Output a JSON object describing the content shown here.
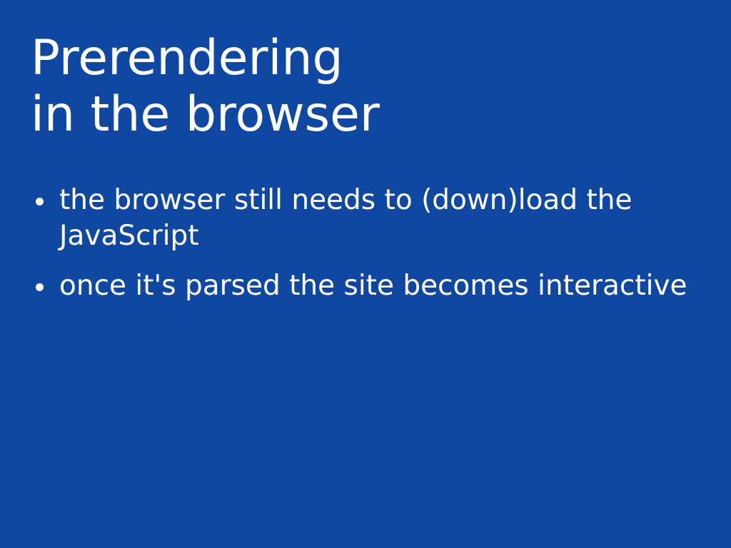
{
  "slide": {
    "title_line1": "Prerendering",
    "title_line2": "in the browser",
    "bullets": [
      "the browser still needs to (down)load the JavaScript",
      "once it's parsed the site becomes interactive"
    ]
  },
  "colors": {
    "background": "#0f47a1",
    "text": "#ffffff"
  }
}
